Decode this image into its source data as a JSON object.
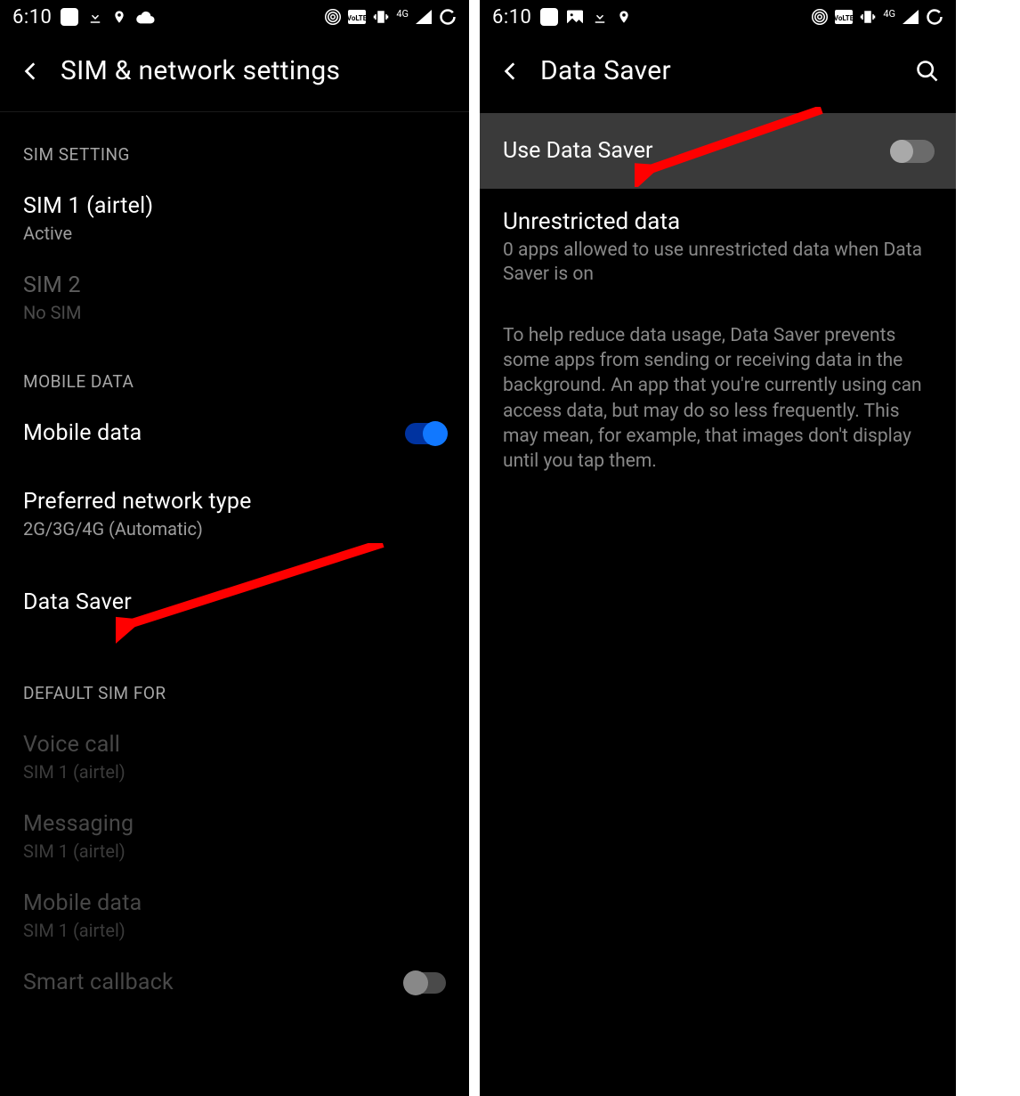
{
  "statusbar": {
    "time": "6:10",
    "signal_label": "4G"
  },
  "left": {
    "header": {
      "title": "SIM & network settings"
    },
    "sections": {
      "sim_setting": "SIM SETTING",
      "mobile_data": "MOBILE DATA",
      "default_sim_for": "DEFAULT SIM FOR"
    },
    "items": {
      "sim1": {
        "title": "SIM 1  (airtel)",
        "subtitle": "Active"
      },
      "sim2": {
        "title": "SIM 2",
        "subtitle": "No SIM"
      },
      "mobile_data": {
        "title": "Mobile data"
      },
      "pref_net": {
        "title": "Preferred network type",
        "subtitle": "2G/3G/4G (Automatic)"
      },
      "data_saver": {
        "title": "Data Saver"
      },
      "voice_call": {
        "title": "Voice call",
        "subtitle": "SIM 1  (airtel)"
      },
      "messaging": {
        "title": "Messaging",
        "subtitle": "SIM 1  (airtel)"
      },
      "mobile_data2": {
        "title": "Mobile data",
        "subtitle": "SIM 1  (airtel)"
      },
      "smart_callback": {
        "title": "Smart callback"
      }
    }
  },
  "right": {
    "header": {
      "title": "Data Saver"
    },
    "use_data_saver": "Use Data Saver",
    "unrestricted": {
      "title": "Unrestricted data",
      "subtitle": "0 apps allowed to use unrestricted data when Data Saver is on"
    },
    "help": "To help reduce data usage, Data Saver prevents some apps from sending or receiving data in the background. An app that you're currently using can access data, but may do so less frequently. This may mean, for example, that images don't display until you tap them."
  }
}
